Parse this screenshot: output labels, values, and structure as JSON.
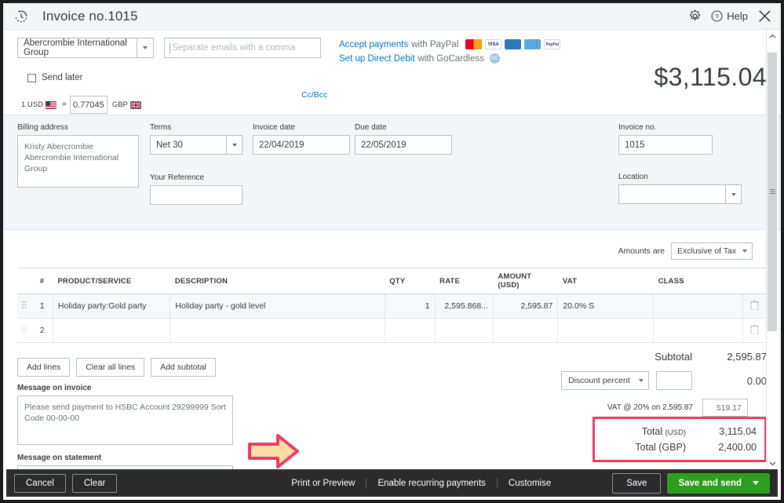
{
  "titlebar": {
    "history_icon": "clock-history-icon",
    "title": "Invoice no.1015",
    "gear_icon": "gear-icon",
    "help_icon": "help-circle-icon",
    "help_label": "Help",
    "close_icon": "close-icon"
  },
  "header": {
    "customer": "Abercrombie International Group",
    "email_placeholder": "Separate emails with a comma",
    "email_value": "",
    "send_later_label": "Send later",
    "send_later_checked": false,
    "cc_bcc_label": "Cc/Bcc",
    "paypal_link": "Accept payments",
    "paypal_suffix": "with PayPal",
    "gocardless_link": "Set up Direct Debit",
    "gocardless_suffix": "with GoCardless",
    "card_badges": [
      "mastercard-icon",
      "visa-icon",
      "amex-icon",
      "bank-transfer-icon",
      "paypal-icon"
    ],
    "gocardless_badge": "gocardless-icon",
    "balance_due": "$3,115.04",
    "fx_from_label": "1 USD",
    "fx_from_flag": "flag-usa-icon",
    "fx_equals": "=",
    "fx_rate": "0.77045",
    "fx_to_label": "GBP",
    "fx_to_flag": "flag-uk-icon"
  },
  "form": {
    "billing_address_label": "Billing address",
    "billing_address_value": "Kristy Abercrombie\nAbercrombie International\nGroup",
    "terms_label": "Terms",
    "terms_value": "Net 30",
    "invoice_date_label": "Invoice date",
    "invoice_date_value": "22/04/2019",
    "due_date_label": "Due date",
    "due_date_value": "22/05/2019",
    "your_reference_label": "Your Reference",
    "your_reference_value": "",
    "invoice_no_label": "Invoice no.",
    "invoice_no_value": "1015",
    "location_label": "Location",
    "location_value": ""
  },
  "items": {
    "amounts_are_label": "Amounts are",
    "amounts_are_value": "Exclusive of Tax",
    "columns": [
      "#",
      "PRODUCT/SERVICE",
      "DESCRIPTION",
      "QTY",
      "RATE",
      "AMOUNT (USD)",
      "VAT",
      "CLASS"
    ],
    "rows": [
      {
        "num": "1",
        "product": "Holiday party:Gold party",
        "description": "Holiday party - gold level",
        "qty": "1",
        "rate": "2,595.868...",
        "amount": "2,595.87",
        "vat": "20.0% S",
        "class": ""
      },
      {
        "num": "2",
        "product": "",
        "description": "",
        "qty": "",
        "rate": "",
        "amount": "",
        "vat": "",
        "class": ""
      }
    ],
    "add_lines": "Add lines",
    "clear_all_lines": "Clear all lines",
    "add_subtotal": "Add subtotal"
  },
  "messages": {
    "invoice_label": "Message on invoice",
    "invoice_value": "Please send payment to HSBC Account 29299999 Sort Code 00-00-00",
    "statement_label": "Message on statement",
    "statement_value": ""
  },
  "totals": {
    "subtotal_label": "Subtotal",
    "subtotal_value": "2,595.87",
    "discount_type": "Discount percent",
    "discount_input": "",
    "discount_value": "0.00",
    "vat_label": "VAT @ 20% on 2,595.87",
    "vat_value": "519.17",
    "total_usd_label": "Total",
    "total_usd_currency": "(USD)",
    "total_usd_value": "3,115.04",
    "total_gbp_label": "Total (GBP)",
    "total_gbp_value": "2,400.00",
    "highlight_border_color": "#ea3a63",
    "annotation_arrow_fill": "#fadfa4",
    "annotation_arrow_stroke": "#ea3a63"
  },
  "footer": {
    "cancel": "Cancel",
    "clear": "Clear",
    "print_or_preview": "Print or Preview",
    "enable_recurring": "Enable recurring payments",
    "customise": "Customise",
    "save": "Save",
    "save_and_send": "Save and send",
    "save_and_send_color": "#2ca01c"
  },
  "scrollbar": {
    "up_icon": "chevron-up-icon",
    "down_icon": "chevron-down-icon",
    "thumb": "scroll-thumb"
  }
}
